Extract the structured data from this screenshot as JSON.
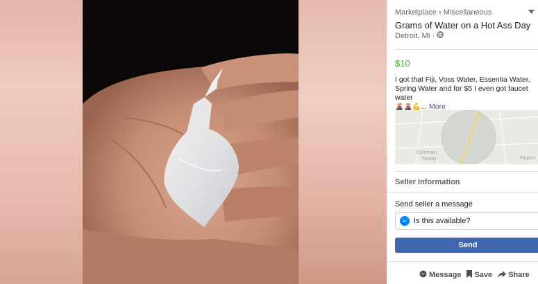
{
  "breadcrumb": {
    "root": "Marketplace",
    "separator": "›",
    "category": "Miscellaneous"
  },
  "listing": {
    "title": "Grams of Water on a Hot Ass Day",
    "location": "Detroit, MI",
    "location_separator": "·",
    "price": "$10",
    "description": "I got that Fiji, Voss Water, Essentia Water, Spring Water and for $5 I even got faucet water",
    "description_emojis": [
      "🌋",
      "🌋",
      "💪"
    ],
    "ellipsis": "...",
    "more_link": "More"
  },
  "map": {
    "labels": [
      "Coleman",
      "Young"
    ],
    "report_link": "Report"
  },
  "seller": {
    "heading": "Seller Information",
    "send_message_label": "Send seller a message",
    "message_value": "Is this available?",
    "send_button": "Send"
  },
  "actions": {
    "message": "Message",
    "save": "Save",
    "share": "Share"
  },
  "colors": {
    "price": "#42b72a",
    "primary_button": "#4267b2",
    "link": "#385898",
    "messenger": "#0084ff"
  },
  "icons": [
    "chevron-down-icon",
    "globe-icon",
    "messenger-icon",
    "message-icon",
    "bookmark-icon",
    "share-icon"
  ]
}
